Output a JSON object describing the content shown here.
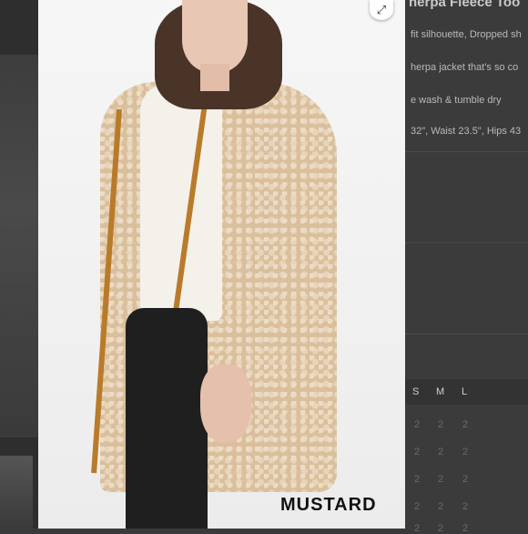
{
  "product": {
    "title": "herpa Fleece Too",
    "details": [
      "fit silhouette, Dropped sh",
      "herpa jacket that's so co",
      "e wash & tumble dry",
      "32\", Waist 23.5\", Hips 43"
    ]
  },
  "size_chart": {
    "headers": [
      "S",
      "M",
      "L"
    ],
    "rows": [
      [
        "2",
        "2",
        "2"
      ],
      [
        "2",
        "2",
        "2"
      ],
      [
        "2",
        "2",
        "2"
      ],
      [
        "2",
        "2",
        "2"
      ],
      [
        "2",
        "2",
        "2"
      ]
    ]
  },
  "viewer": {
    "caption": "MUSTARD",
    "expand_icon": "expand-icon",
    "expand_glyph": "⤢"
  },
  "colors": {
    "overlay": "#3b3b3b",
    "trim": "#b97b2a",
    "coat": "#d9bf9b"
  }
}
